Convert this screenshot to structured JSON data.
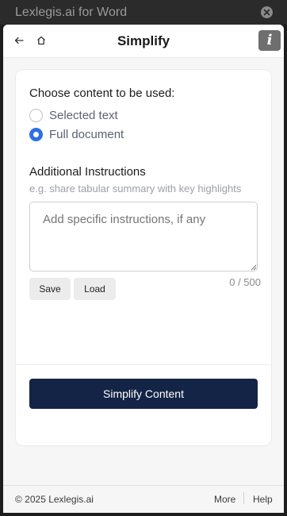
{
  "window": {
    "title": "Lexlegis.ai for Word"
  },
  "header": {
    "title": "Simplify",
    "info_glyph": "i"
  },
  "content_choice": {
    "title": "Choose content to be used:",
    "options": [
      {
        "label": "Selected text",
        "checked": false
      },
      {
        "label": "Full document",
        "checked": true
      }
    ]
  },
  "instructions": {
    "title": "Additional Instructions",
    "hint": "e.g. share tabular summary with key highlights",
    "placeholder": "Add specific instructions, if any",
    "value": "",
    "counter": "0 / 500",
    "save_label": "Save",
    "load_label": "Load"
  },
  "primary_action": {
    "label": "Simplify Content"
  },
  "footer": {
    "copyright": "© 2025 Lexlegis.ai",
    "more_label": "More",
    "help_label": "Help"
  },
  "colors": {
    "accent": "#2f6fe6",
    "primary_button": "#142446"
  },
  "icons": {
    "back": "arrow-left",
    "home": "home",
    "close": "circle-x",
    "info": "info"
  }
}
